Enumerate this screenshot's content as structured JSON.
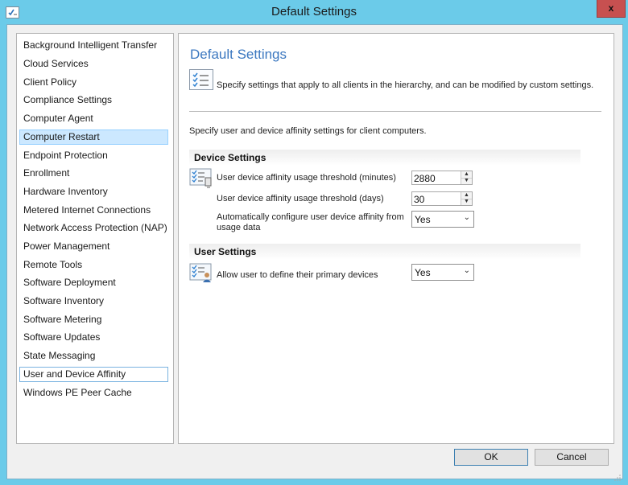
{
  "window": {
    "title": "Default Settings",
    "app_icon": "settings-check-icon",
    "close_label": "x"
  },
  "nav": {
    "items": [
      {
        "label": "Background Intelligent Transfer"
      },
      {
        "label": "Cloud Services"
      },
      {
        "label": "Client Policy"
      },
      {
        "label": "Compliance Settings"
      },
      {
        "label": "Computer Agent"
      },
      {
        "label": "Computer Restart",
        "state": "selected"
      },
      {
        "label": "Endpoint Protection"
      },
      {
        "label": "Enrollment"
      },
      {
        "label": "Hardware Inventory"
      },
      {
        "label": "Metered Internet Connections"
      },
      {
        "label": "Network Access Protection (NAP)"
      },
      {
        "label": "Power Management"
      },
      {
        "label": "Remote Tools"
      },
      {
        "label": "Software Deployment"
      },
      {
        "label": "Software Inventory"
      },
      {
        "label": "Software Metering"
      },
      {
        "label": "Software Updates"
      },
      {
        "label": "State Messaging"
      },
      {
        "label": "User and Device Affinity",
        "state": "focused"
      },
      {
        "label": "Windows PE Peer Cache"
      }
    ]
  },
  "panel": {
    "title": "Default Settings",
    "description": "Specify settings that apply to all clients in the hierarchy, and can be modified by custom settings.",
    "sub_description": "Specify user and device affinity settings for client computers.",
    "device_settings": {
      "heading": "Device Settings",
      "minutes_label": "User device affinity usage threshold (minutes)",
      "minutes_value": "2880",
      "days_label": "User device affinity usage threshold (days)",
      "days_value": "30",
      "auto_label_line1": "Automatically configure user device affinity from",
      "auto_label_line2": "usage data",
      "auto_value": "Yes"
    },
    "user_settings": {
      "heading": "User Settings",
      "allow_label": "Allow user to define their primary devices",
      "allow_value": "Yes"
    }
  },
  "buttons": {
    "ok": "OK",
    "cancel": "Cancel"
  },
  "colors": {
    "titlebar": "#6bcbe9",
    "close": "#c75050",
    "accent_title": "#3c78c0",
    "selection": "#cce8ff"
  }
}
